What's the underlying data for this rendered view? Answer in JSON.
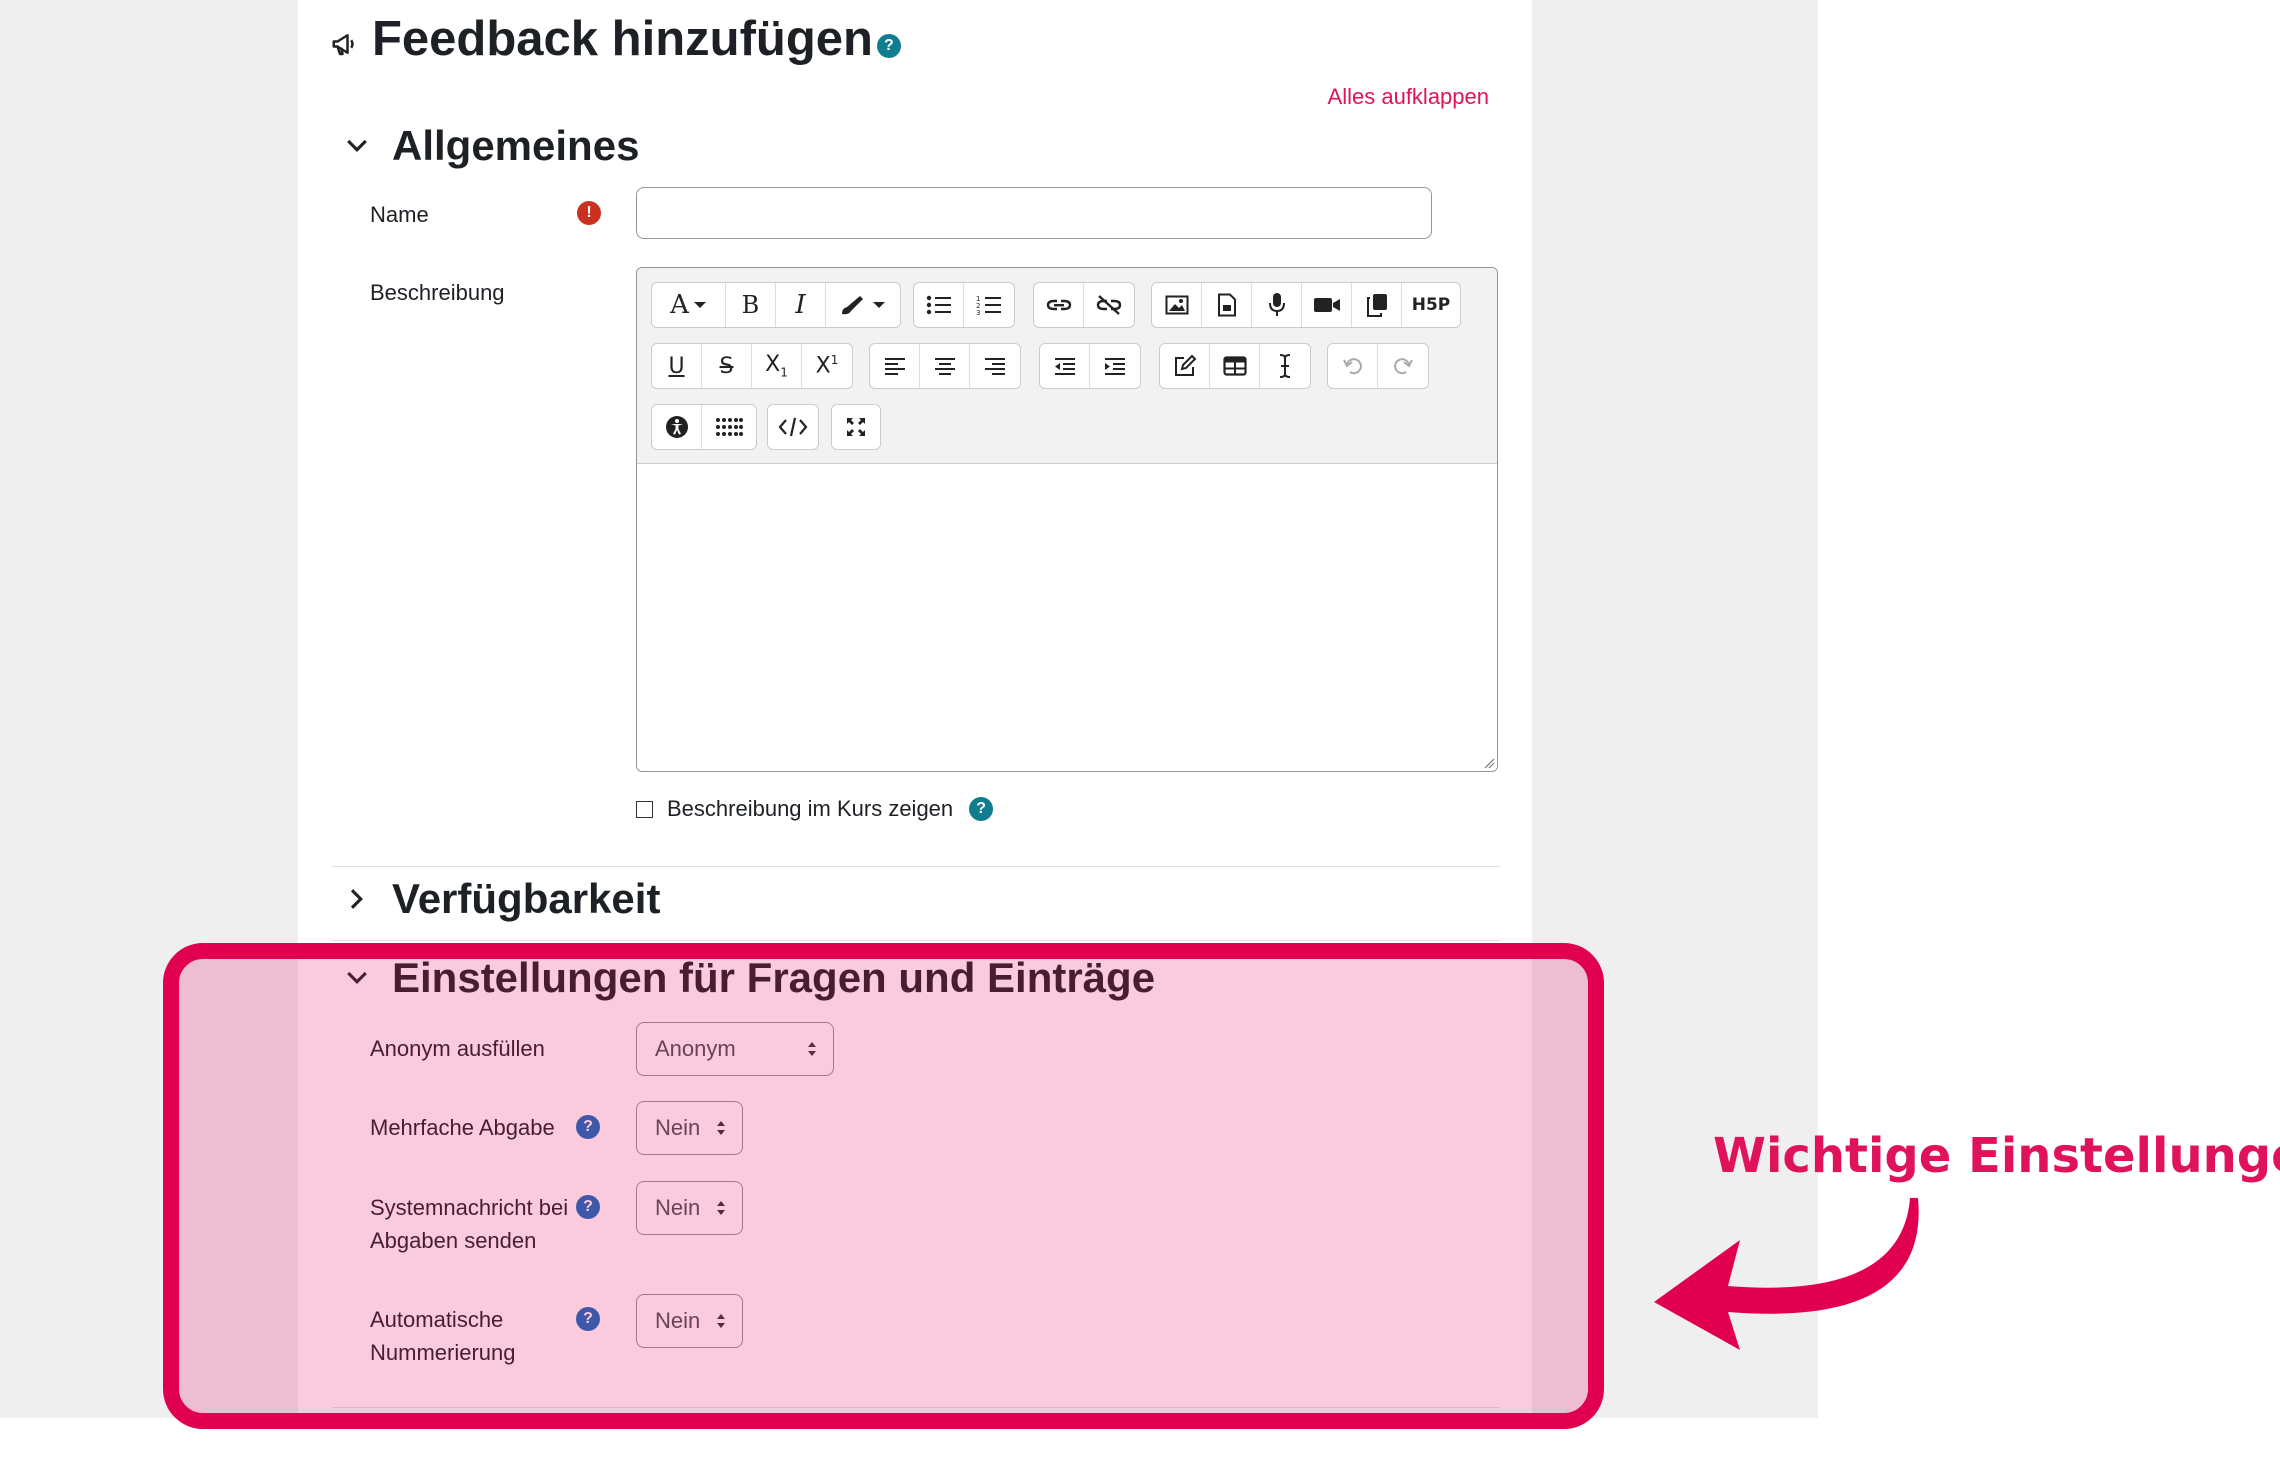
{
  "page": {
    "title": "Feedback hinzufügen",
    "expand_all": "Alles aufklappen"
  },
  "sections": {
    "general": {
      "title": "Allgemeines",
      "name_label": "Name",
      "name_value": "",
      "description_label": "Beschreibung",
      "show_description_label": "Beschreibung im Kurs zeigen"
    },
    "availability": {
      "title": "Verfügbarkeit"
    },
    "questions": {
      "title": "Einstellungen für Fragen und Einträge",
      "anonymous_label": "Anonym ausfüllen",
      "anonymous_value": "Anonym",
      "multiple_label": "Mehrfache Abgabe",
      "multiple_value": "Nein",
      "notify_label_line1": "Systemnachricht bei",
      "notify_label_line2": "Abgaben senden",
      "notify_value": "Nein",
      "autonumber_label_line1": "Automatische",
      "autonumber_label_line2": "Nummerierung",
      "autonumber_value": "Nein"
    }
  },
  "toolbar": {
    "row1": [
      "font-size",
      "bold",
      "italic",
      "text-color",
      "unordered-list",
      "ordered-list",
      "link",
      "unlink",
      "image",
      "media-file",
      "record-audio",
      "record-video",
      "manage-files",
      "h5p"
    ],
    "row2": [
      "underline",
      "strikethrough",
      "subscript",
      "superscript",
      "align-left",
      "align-center",
      "align-right",
      "outdent",
      "indent",
      "equation",
      "table",
      "special-char",
      "undo",
      "redo"
    ],
    "row3": [
      "accessibility-checker",
      "screenreader-helper",
      "html-source",
      "fullscreen"
    ],
    "h5p_label": "H5P"
  },
  "annotation": {
    "text": "Wichtige Einstellungen!"
  },
  "colors": {
    "accent": "#e0125b",
    "highlight_border": "#e0004f",
    "help_icon": "#0f6cbf",
    "required_icon": "#ca3120"
  }
}
